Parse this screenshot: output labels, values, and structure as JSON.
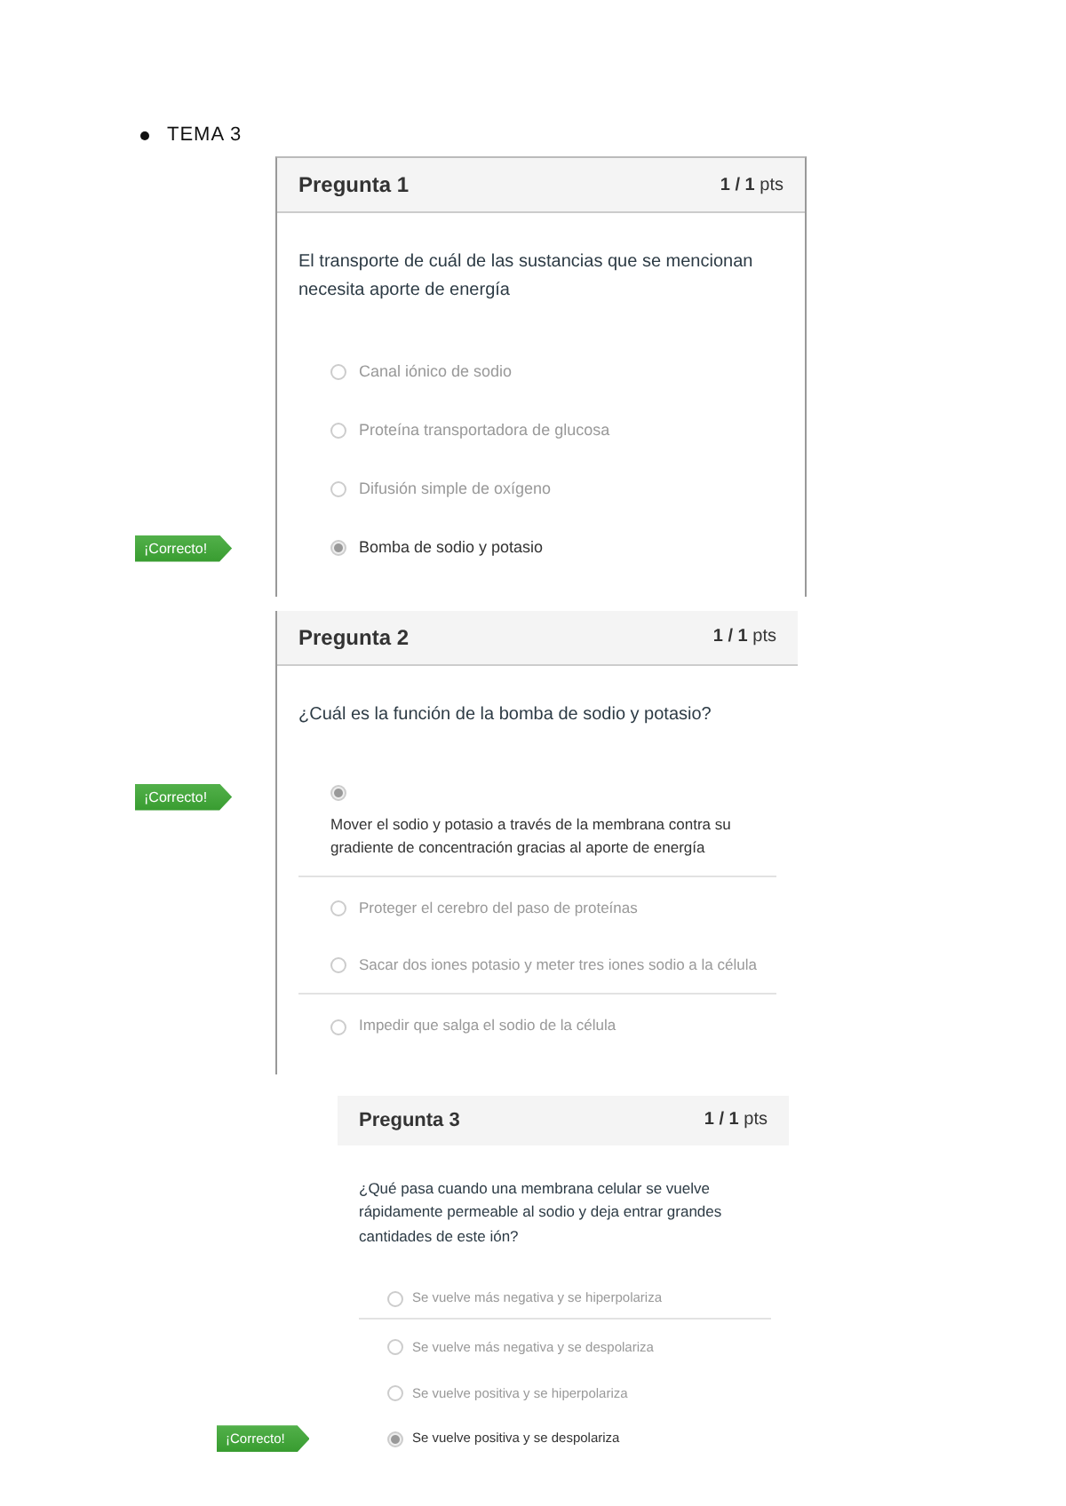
{
  "bullet": "TEMA 3",
  "questions": [
    {
      "kind": "boxed",
      "title": "Pregunta 1",
      "score": "1 / 1",
      "unit": "pts",
      "text": "El transporte de cuál de las sustancias que se mencionan necesita aporte de energía",
      "badge": "¡Correcto!",
      "answers": [
        {
          "label": "Canal iónico de sodio",
          "selected": false,
          "divider": false
        },
        {
          "label": "Proteína transportadora de glucosa",
          "selected": false,
          "divider": false
        },
        {
          "label": "Difusión simple de oxígeno",
          "selected": false,
          "divider": false
        },
        {
          "label": "Bomba de sodio y potasio",
          "selected": true,
          "divider": false
        }
      ]
    },
    {
      "kind": "ruled",
      "title": "Pregunta 2",
      "score": "1 / 1",
      "unit": "pts",
      "text": "¿Cuál es la función de la bomba de sodio y potasio?",
      "badge": "¡Correcto!",
      "answers": [
        {
          "label": "Mover el sodio y potasio a través de la membrana contra su gradiente de concentración gracias al aporte de energía",
          "selected": true,
          "divider": true
        },
        {
          "label": "Proteger el cerebro del paso de proteínas",
          "selected": false,
          "divider": false
        },
        {
          "label": "Sacar dos iones potasio y meter tres iones sodio a la célula",
          "selected": false,
          "divider": true
        },
        {
          "label": "Impedir que salga el sodio de la célula",
          "selected": false,
          "divider": false
        }
      ]
    },
    {
      "kind": "plain",
      "title": "Pregunta 3",
      "score": "1 / 1",
      "unit": "pts",
      "text": "¿Qué pasa cuando una membrana celular se vuelve rápidamente permeable al sodio y deja entrar grandes cantidades de este ión?",
      "badge": "¡Correcto!",
      "answers": [
        {
          "label": "Se vuelve más negativa y se hiperpolariza",
          "selected": false,
          "divider": true
        },
        {
          "label": "Se vuelve más negativa y se despolariza",
          "selected": false,
          "divider": false
        },
        {
          "label": "Se vuelve positiva y se hiperpolariza",
          "selected": false,
          "divider": false
        },
        {
          "label": "Se vuelve positiva y se despolariza",
          "selected": true,
          "divider": false
        }
      ]
    }
  ]
}
